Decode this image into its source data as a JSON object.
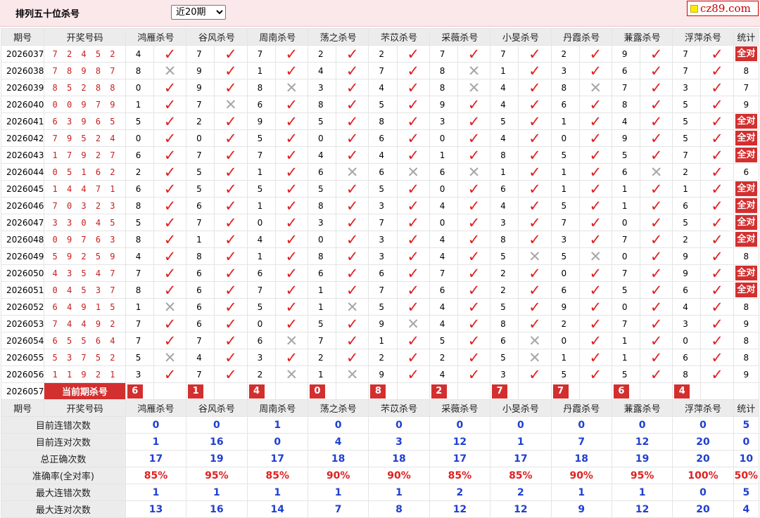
{
  "header": {
    "title": "排列五十位杀号",
    "period_select": "近20期",
    "logo_text": "cz89.com"
  },
  "columns": {
    "issue": "期号",
    "draw": "开奖号码",
    "experts": [
      "鸿雁杀号",
      "谷风杀号",
      "周南杀号",
      "荡之杀号",
      "芣苡杀号",
      "采薇杀号",
      "小旻杀号",
      "丹霞杀号",
      "蒹露杀号",
      "浮萍杀号"
    ],
    "stats": "统计"
  },
  "rows": [
    {
      "issue": "2026037",
      "draw": "7 2 4 5 2",
      "kills": [
        [
          4,
          1
        ],
        [
          7,
          1
        ],
        [
          7,
          1
        ],
        [
          2,
          1
        ],
        [
          2,
          1
        ],
        [
          7,
          1
        ],
        [
          7,
          1
        ],
        [
          2,
          1
        ],
        [
          9,
          1
        ],
        [
          7,
          1
        ]
      ],
      "stat": "全对"
    },
    {
      "issue": "2026038",
      "draw": "7 8 9 8 7",
      "kills": [
        [
          8,
          0
        ],
        [
          9,
          1
        ],
        [
          1,
          1
        ],
        [
          4,
          1
        ],
        [
          7,
          1
        ],
        [
          8,
          0
        ],
        [
          1,
          1
        ],
        [
          3,
          1
        ],
        [
          6,
          1
        ],
        [
          7,
          1
        ]
      ],
      "stat": "8"
    },
    {
      "issue": "2026039",
      "draw": "8 5 2 8 8",
      "kills": [
        [
          0,
          1
        ],
        [
          9,
          1
        ],
        [
          8,
          0
        ],
        [
          3,
          1
        ],
        [
          4,
          1
        ],
        [
          8,
          0
        ],
        [
          4,
          1
        ],
        [
          8,
          0
        ],
        [
          7,
          1
        ],
        [
          3,
          1
        ]
      ],
      "stat": "7"
    },
    {
      "issue": "2026040",
      "draw": "0 0 9 7 9",
      "kills": [
        [
          1,
          1
        ],
        [
          7,
          0
        ],
        [
          6,
          1
        ],
        [
          8,
          1
        ],
        [
          5,
          1
        ],
        [
          9,
          1
        ],
        [
          4,
          1
        ],
        [
          6,
          1
        ],
        [
          8,
          1
        ],
        [
          5,
          1
        ]
      ],
      "stat": "9"
    },
    {
      "issue": "2026041",
      "draw": "6 3 9 6 5",
      "kills": [
        [
          5,
          1
        ],
        [
          2,
          1
        ],
        [
          9,
          1
        ],
        [
          5,
          1
        ],
        [
          8,
          1
        ],
        [
          3,
          1
        ],
        [
          5,
          1
        ],
        [
          1,
          1
        ],
        [
          4,
          1
        ],
        [
          5,
          1
        ]
      ],
      "stat": "全对"
    },
    {
      "issue": "2026042",
      "draw": "7 9 5 2 4",
      "kills": [
        [
          0,
          1
        ],
        [
          0,
          1
        ],
        [
          5,
          1
        ],
        [
          0,
          1
        ],
        [
          6,
          1
        ],
        [
          0,
          1
        ],
        [
          4,
          1
        ],
        [
          0,
          1
        ],
        [
          9,
          1
        ],
        [
          5,
          1
        ]
      ],
      "stat": "全对"
    },
    {
      "issue": "2026043",
      "draw": "1 7 9 2 7",
      "kills": [
        [
          6,
          1
        ],
        [
          7,
          1
        ],
        [
          7,
          1
        ],
        [
          4,
          1
        ],
        [
          4,
          1
        ],
        [
          1,
          1
        ],
        [
          8,
          1
        ],
        [
          5,
          1
        ],
        [
          5,
          1
        ],
        [
          7,
          1
        ]
      ],
      "stat": "全对"
    },
    {
      "issue": "2026044",
      "draw": "0 5 1 6 2",
      "kills": [
        [
          2,
          1
        ],
        [
          5,
          1
        ],
        [
          1,
          1
        ],
        [
          6,
          0
        ],
        [
          6,
          0
        ],
        [
          6,
          0
        ],
        [
          1,
          1
        ],
        [
          1,
          1
        ],
        [
          6,
          0
        ],
        [
          2,
          1
        ]
      ],
      "stat": "6"
    },
    {
      "issue": "2026045",
      "draw": "1 4 4 7 1",
      "kills": [
        [
          6,
          1
        ],
        [
          5,
          1
        ],
        [
          5,
          1
        ],
        [
          5,
          1
        ],
        [
          5,
          1
        ],
        [
          0,
          1
        ],
        [
          6,
          1
        ],
        [
          1,
          1
        ],
        [
          1,
          1
        ],
        [
          1,
          1
        ]
      ],
      "stat": "全对"
    },
    {
      "issue": "2026046",
      "draw": "7 0 3 2 3",
      "kills": [
        [
          8,
          1
        ],
        [
          6,
          1
        ],
        [
          1,
          1
        ],
        [
          8,
          1
        ],
        [
          3,
          1
        ],
        [
          4,
          1
        ],
        [
          4,
          1
        ],
        [
          5,
          1
        ],
        [
          1,
          1
        ],
        [
          6,
          1
        ]
      ],
      "stat": "全对"
    },
    {
      "issue": "2026047",
      "draw": "3 3 0 4 5",
      "kills": [
        [
          5,
          1
        ],
        [
          7,
          1
        ],
        [
          0,
          1
        ],
        [
          3,
          1
        ],
        [
          7,
          1
        ],
        [
          0,
          1
        ],
        [
          3,
          1
        ],
        [
          7,
          1
        ],
        [
          0,
          1
        ],
        [
          5,
          1
        ]
      ],
      "stat": "全对"
    },
    {
      "issue": "2026048",
      "draw": "0 9 7 6 3",
      "kills": [
        [
          8,
          1
        ],
        [
          1,
          1
        ],
        [
          4,
          1
        ],
        [
          0,
          1
        ],
        [
          3,
          1
        ],
        [
          4,
          1
        ],
        [
          8,
          1
        ],
        [
          3,
          1
        ],
        [
          7,
          1
        ],
        [
          2,
          1
        ]
      ],
      "stat": "全对"
    },
    {
      "issue": "2026049",
      "draw": "5 9 2 5 9",
      "kills": [
        [
          4,
          1
        ],
        [
          8,
          1
        ],
        [
          1,
          1
        ],
        [
          8,
          1
        ],
        [
          3,
          1
        ],
        [
          4,
          1
        ],
        [
          5,
          0
        ],
        [
          5,
          0
        ],
        [
          0,
          1
        ],
        [
          9,
          1
        ]
      ],
      "stat": "8"
    },
    {
      "issue": "2026050",
      "draw": "4 3 5 4 7",
      "kills": [
        [
          7,
          1
        ],
        [
          6,
          1
        ],
        [
          6,
          1
        ],
        [
          6,
          1
        ],
        [
          6,
          1
        ],
        [
          7,
          1
        ],
        [
          2,
          1
        ],
        [
          0,
          1
        ],
        [
          7,
          1
        ],
        [
          9,
          1
        ]
      ],
      "stat": "全对"
    },
    {
      "issue": "2026051",
      "draw": "0 4 5 3 7",
      "kills": [
        [
          8,
          1
        ],
        [
          6,
          1
        ],
        [
          7,
          1
        ],
        [
          1,
          1
        ],
        [
          7,
          1
        ],
        [
          6,
          1
        ],
        [
          2,
          1
        ],
        [
          6,
          1
        ],
        [
          5,
          1
        ],
        [
          6,
          1
        ]
      ],
      "stat": "全对"
    },
    {
      "issue": "2026052",
      "draw": "6 4 9 1 5",
      "kills": [
        [
          1,
          0
        ],
        [
          6,
          1
        ],
        [
          5,
          1
        ],
        [
          1,
          0
        ],
        [
          5,
          1
        ],
        [
          4,
          1
        ],
        [
          5,
          1
        ],
        [
          9,
          1
        ],
        [
          0,
          1
        ],
        [
          4,
          1
        ]
      ],
      "stat": "8"
    },
    {
      "issue": "2026053",
      "draw": "7 4 4 9 2",
      "kills": [
        [
          7,
          1
        ],
        [
          6,
          1
        ],
        [
          0,
          1
        ],
        [
          5,
          1
        ],
        [
          9,
          0
        ],
        [
          4,
          1
        ],
        [
          8,
          1
        ],
        [
          2,
          1
        ],
        [
          7,
          1
        ],
        [
          3,
          1
        ]
      ],
      "stat": "9"
    },
    {
      "issue": "2026054",
      "draw": "6 5 5 6 4",
      "kills": [
        [
          7,
          1
        ],
        [
          7,
          1
        ],
        [
          6,
          0
        ],
        [
          7,
          1
        ],
        [
          1,
          1
        ],
        [
          5,
          1
        ],
        [
          6,
          0
        ],
        [
          0,
          1
        ],
        [
          1,
          1
        ],
        [
          0,
          1
        ]
      ],
      "stat": "8"
    },
    {
      "issue": "2026055",
      "draw": "5 3 7 5 2",
      "kills": [
        [
          5,
          0
        ],
        [
          4,
          1
        ],
        [
          3,
          1
        ],
        [
          2,
          1
        ],
        [
          2,
          1
        ],
        [
          2,
          1
        ],
        [
          5,
          0
        ],
        [
          1,
          1
        ],
        [
          1,
          1
        ],
        [
          6,
          1
        ]
      ],
      "stat": "8"
    },
    {
      "issue": "2026056",
      "draw": "1 1 9 2 1",
      "kills": [
        [
          3,
          1
        ],
        [
          7,
          1
        ],
        [
          2,
          0
        ],
        [
          1,
          0
        ],
        [
          9,
          1
        ],
        [
          4,
          1
        ],
        [
          3,
          1
        ],
        [
          5,
          1
        ],
        [
          5,
          1
        ],
        [
          8,
          1
        ]
      ],
      "stat": "9"
    }
  ],
  "current": {
    "issue": "2026057",
    "label": "当前期杀号",
    "kills": [
      "6",
      "1",
      "4",
      "0",
      "8",
      "2",
      "7",
      "7",
      "6",
      "4"
    ]
  },
  "marks": {
    "ok": "✓",
    "bad": "✕"
  },
  "summary": [
    {
      "label": "目前连错次数",
      "color": "blue",
      "values": [
        "0",
        "0",
        "1",
        "0",
        "0",
        "0",
        "0",
        "0",
        "0",
        "0"
      ],
      "stat": "5"
    },
    {
      "label": "目前连对次数",
      "color": "blue",
      "values": [
        "1",
        "16",
        "0",
        "4",
        "3",
        "12",
        "1",
        "7",
        "12",
        "20"
      ],
      "stat": "0"
    },
    {
      "label": "总正确次数",
      "color": "blue",
      "values": [
        "17",
        "19",
        "17",
        "18",
        "18",
        "17",
        "17",
        "18",
        "19",
        "20"
      ],
      "stat": "10"
    },
    {
      "label": "准确率(全对率)",
      "color": "red",
      "values": [
        "85%",
        "95%",
        "85%",
        "90%",
        "90%",
        "85%",
        "85%",
        "90%",
        "95%",
        "100%"
      ],
      "stat": "50%"
    },
    {
      "label": "最大连错次数",
      "color": "blue",
      "values": [
        "1",
        "1",
        "1",
        "1",
        "1",
        "2",
        "2",
        "1",
        "1",
        "0"
      ],
      "stat": "5"
    },
    {
      "label": "最大连对次数",
      "color": "blue",
      "values": [
        "13",
        "16",
        "14",
        "7",
        "8",
        "12",
        "12",
        "9",
        "12",
        "20"
      ],
      "stat": "4"
    }
  ]
}
